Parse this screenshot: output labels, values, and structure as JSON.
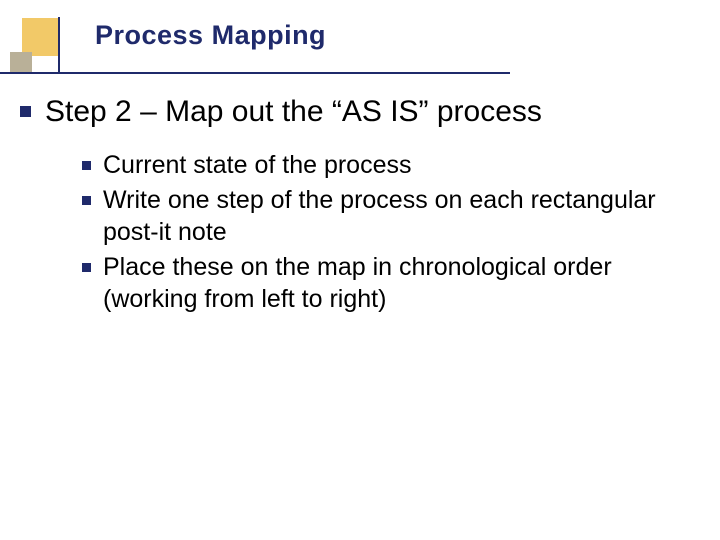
{
  "title": "Process Mapping",
  "main_bullet": "Step 2 – Map out the “AS IS” process",
  "sub_bullets": [
    "Current state of the process",
    "Write one step of the process on each rectangular post-it note",
    "Place these on the map in chronological order (working from left to right)"
  ],
  "colors": {
    "accent": "#1f2a6b",
    "gold": "#f2c968",
    "gray": "#b9b098"
  }
}
